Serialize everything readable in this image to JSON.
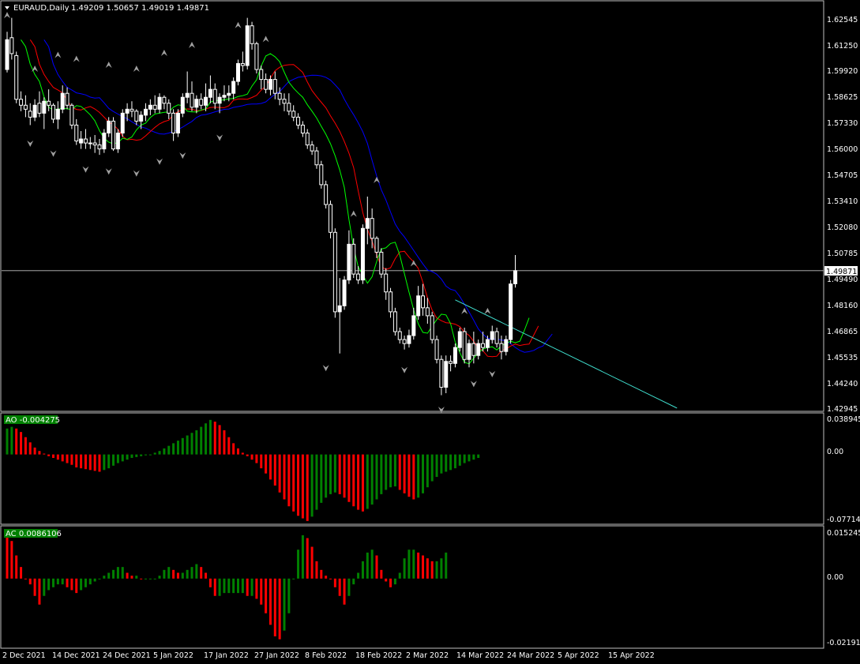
{
  "header": {
    "symbol_timeframe": "EURAUD,Daily",
    "ohlc": "1.49209 1.50657 1.49019 1.49871"
  },
  "main_scale": {
    "ticks": [
      "1.62545",
      "1.61250",
      "1.59920",
      "1.58625",
      "1.57330",
      "1.56000",
      "1.54705",
      "1.53410",
      "1.52080",
      "1.50785",
      "1.49490",
      "1.48160",
      "1.46865",
      "1.45535",
      "1.44240",
      "1.42945"
    ],
    "current_price_label": "1.49871"
  },
  "ao_panel": {
    "label": "AO -0.004275",
    "ticks": [
      "0.038945",
      "0.00",
      "-0.077144"
    ]
  },
  "ac_panel": {
    "label": "AC 0.0086106",
    "ticks": [
      "0.0152458",
      "0.00",
      "-0.0219111"
    ]
  },
  "time_axis": {
    "labels": [
      "2 Dec 2021",
      "14 Dec 2021",
      "24 Dec 2021",
      "5 Jan 2022",
      "17 Jan 2022",
      "27 Jan 2022",
      "8 Feb 2022",
      "18 Feb 2022",
      "2 Mar 2022",
      "14 Mar 2022",
      "24 Mar 2022",
      "5 Apr 2022",
      "15 Apr 2022"
    ]
  },
  "colors": {
    "background": "#000000",
    "bull_candle": "#ffffff",
    "bear_candle": "#000000",
    "green_bar": "#008000",
    "red_bar": "#ff0000",
    "ma_blue": "#0000ff",
    "ma_red": "#ff0000",
    "ma_green": "#00ff00",
    "trendline": "#40e0d0",
    "price_line": "#c0c0c0"
  },
  "chart_data": {
    "type": "candlestick",
    "symbol": "EURAUD",
    "timeframe": "Daily",
    "candles": [
      {
        "o": 1.6,
        "h": 1.619,
        "l": 1.5985,
        "c": 1.615
      },
      {
        "o": 1.616,
        "h": 1.626,
        "l": 1.605,
        "c": 1.608
      },
      {
        "o": 1.607,
        "h": 1.609,
        "l": 1.583,
        "c": 1.585
      },
      {
        "o": 1.585,
        "h": 1.589,
        "l": 1.579,
        "c": 1.582
      },
      {
        "o": 1.582,
        "h": 1.587,
        "l": 1.576,
        "c": 1.58
      },
      {
        "o": 1.579,
        "h": 1.583,
        "l": 1.572,
        "c": 1.576
      },
      {
        "o": 1.576,
        "h": 1.585,
        "l": 1.574,
        "c": 1.582
      },
      {
        "o": 1.583,
        "h": 1.589,
        "l": 1.576,
        "c": 1.578
      },
      {
        "o": 1.578,
        "h": 1.586,
        "l": 1.57,
        "c": 1.584
      },
      {
        "o": 1.584,
        "h": 1.59,
        "l": 1.579,
        "c": 1.582
      },
      {
        "o": 1.582,
        "h": 1.583,
        "l": 1.573,
        "c": 1.575
      },
      {
        "o": 1.575,
        "h": 1.584,
        "l": 1.57,
        "c": 1.58
      },
      {
        "o": 1.58,
        "h": 1.592,
        "l": 1.578,
        "c": 1.588
      },
      {
        "o": 1.588,
        "h": 1.591,
        "l": 1.58,
        "c": 1.582
      },
      {
        "o": 1.582,
        "h": 1.583,
        "l": 1.57,
        "c": 1.572
      },
      {
        "o": 1.572,
        "h": 1.575,
        "l": 1.562,
        "c": 1.564
      },
      {
        "o": 1.563,
        "h": 1.569,
        "l": 1.56,
        "c": 1.565
      },
      {
        "o": 1.565,
        "h": 1.57,
        "l": 1.56,
        "c": 1.563
      },
      {
        "o": 1.563,
        "h": 1.566,
        "l": 1.56,
        "c": 1.563
      },
      {
        "o": 1.563,
        "h": 1.567,
        "l": 1.558,
        "c": 1.562
      },
      {
        "o": 1.562,
        "h": 1.565,
        "l": 1.557,
        "c": 1.56
      },
      {
        "o": 1.56,
        "h": 1.57,
        "l": 1.558,
        "c": 1.568
      },
      {
        "o": 1.568,
        "h": 1.576,
        "l": 1.566,
        "c": 1.574
      },
      {
        "o": 1.574,
        "h": 1.576,
        "l": 1.559,
        "c": 1.56
      },
      {
        "o": 1.56,
        "h": 1.57,
        "l": 1.558,
        "c": 1.568
      },
      {
        "o": 1.568,
        "h": 1.58,
        "l": 1.566,
        "c": 1.578
      },
      {
        "o": 1.578,
        "h": 1.583,
        "l": 1.574,
        "c": 1.58
      },
      {
        "o": 1.58,
        "h": 1.584,
        "l": 1.576,
        "c": 1.579
      },
      {
        "o": 1.579,
        "h": 1.58,
        "l": 1.572,
        "c": 1.574
      },
      {
        "o": 1.574,
        "h": 1.579,
        "l": 1.57,
        "c": 1.577
      },
      {
        "o": 1.577,
        "h": 1.583,
        "l": 1.574,
        "c": 1.58
      },
      {
        "o": 1.58,
        "h": 1.585,
        "l": 1.577,
        "c": 1.582
      },
      {
        "o": 1.582,
        "h": 1.587,
        "l": 1.578,
        "c": 1.58
      },
      {
        "o": 1.58,
        "h": 1.588,
        "l": 1.578,
        "c": 1.586
      },
      {
        "o": 1.586,
        "h": 1.587,
        "l": 1.58,
        "c": 1.583
      },
      {
        "o": 1.583,
        "h": 1.585,
        "l": 1.575,
        "c": 1.578
      },
      {
        "o": 1.578,
        "h": 1.58,
        "l": 1.564,
        "c": 1.568
      },
      {
        "o": 1.568,
        "h": 1.58,
        "l": 1.566,
        "c": 1.578
      },
      {
        "o": 1.578,
        "h": 1.588,
        "l": 1.576,
        "c": 1.586
      },
      {
        "o": 1.586,
        "h": 1.599,
        "l": 1.583,
        "c": 1.588
      },
      {
        "o": 1.588,
        "h": 1.594,
        "l": 1.579,
        "c": 1.581
      },
      {
        "o": 1.581,
        "h": 1.587,
        "l": 1.578,
        "c": 1.585
      },
      {
        "o": 1.585,
        "h": 1.588,
        "l": 1.58,
        "c": 1.582
      },
      {
        "o": 1.582,
        "h": 1.593,
        "l": 1.579,
        "c": 1.586
      },
      {
        "o": 1.586,
        "h": 1.597,
        "l": 1.583,
        "c": 1.59
      },
      {
        "o": 1.59,
        "h": 1.593,
        "l": 1.58,
        "c": 1.583
      },
      {
        "o": 1.583,
        "h": 1.588,
        "l": 1.578,
        "c": 1.586
      },
      {
        "o": 1.586,
        "h": 1.592,
        "l": 1.584,
        "c": 1.587
      },
      {
        "o": 1.587,
        "h": 1.592,
        "l": 1.584,
        "c": 1.588
      },
      {
        "o": 1.588,
        "h": 1.596,
        "l": 1.585,
        "c": 1.594
      },
      {
        "o": 1.594,
        "h": 1.605,
        "l": 1.592,
        "c": 1.603
      },
      {
        "o": 1.603,
        "h": 1.609,
        "l": 1.599,
        "c": 1.602
      },
      {
        "o": 1.602,
        "h": 1.626,
        "l": 1.6,
        "c": 1.622
      },
      {
        "o": 1.622,
        "h": 1.624,
        "l": 1.61,
        "c": 1.613
      },
      {
        "o": 1.613,
        "h": 1.614,
        "l": 1.598,
        "c": 1.6
      },
      {
        "o": 1.6,
        "h": 1.602,
        "l": 1.59,
        "c": 1.595
      },
      {
        "o": 1.595,
        "h": 1.598,
        "l": 1.588,
        "c": 1.59
      },
      {
        "o": 1.59,
        "h": 1.597,
        "l": 1.587,
        "c": 1.595
      },
      {
        "o": 1.595,
        "h": 1.599,
        "l": 1.585,
        "c": 1.588
      },
      {
        "o": 1.588,
        "h": 1.591,
        "l": 1.582,
        "c": 1.585
      },
      {
        "o": 1.585,
        "h": 1.588,
        "l": 1.579,
        "c": 1.583
      },
      {
        "o": 1.583,
        "h": 1.588,
        "l": 1.577,
        "c": 1.579
      },
      {
        "o": 1.579,
        "h": 1.582,
        "l": 1.574,
        "c": 1.576
      },
      {
        "o": 1.576,
        "h": 1.578,
        "l": 1.57,
        "c": 1.572
      },
      {
        "o": 1.572,
        "h": 1.574,
        "l": 1.566,
        "c": 1.568
      },
      {
        "o": 1.568,
        "h": 1.57,
        "l": 1.56,
        "c": 1.562
      },
      {
        "o": 1.562,
        "h": 1.564,
        "l": 1.557,
        "c": 1.559
      },
      {
        "o": 1.559,
        "h": 1.561,
        "l": 1.55,
        "c": 1.552
      },
      {
        "o": 1.552,
        "h": 1.554,
        "l": 1.54,
        "c": 1.542
      },
      {
        "o": 1.542,
        "h": 1.544,
        "l": 1.53,
        "c": 1.532
      },
      {
        "o": 1.532,
        "h": 1.534,
        "l": 1.515,
        "c": 1.518
      },
      {
        "o": 1.518,
        "h": 1.52,
        "l": 1.475,
        "c": 1.478
      },
      {
        "o": 1.478,
        "h": 1.495,
        "l": 1.457,
        "c": 1.481
      },
      {
        "o": 1.481,
        "h": 1.496,
        "l": 1.479,
        "c": 1.494
      },
      {
        "o": 1.494,
        "h": 1.519,
        "l": 1.492,
        "c": 1.512
      },
      {
        "o": 1.512,
        "h": 1.515,
        "l": 1.495,
        "c": 1.497
      },
      {
        "o": 1.497,
        "h": 1.501,
        "l": 1.492,
        "c": 1.494
      },
      {
        "o": 1.494,
        "h": 1.522,
        "l": 1.492,
        "c": 1.52
      },
      {
        "o": 1.52,
        "h": 1.536,
        "l": 1.512,
        "c": 1.525
      },
      {
        "o": 1.525,
        "h": 1.53,
        "l": 1.51,
        "c": 1.515
      },
      {
        "o": 1.515,
        "h": 1.516,
        "l": 1.505,
        "c": 1.508
      },
      {
        "o": 1.508,
        "h": 1.51,
        "l": 1.495,
        "c": 1.497
      },
      {
        "o": 1.497,
        "h": 1.5,
        "l": 1.484,
        "c": 1.488
      },
      {
        "o": 1.488,
        "h": 1.49,
        "l": 1.475,
        "c": 1.478
      },
      {
        "o": 1.478,
        "h": 1.48,
        "l": 1.466,
        "c": 1.468
      },
      {
        "o": 1.468,
        "h": 1.47,
        "l": 1.462,
        "c": 1.464
      },
      {
        "o": 1.464,
        "h": 1.466,
        "l": 1.459,
        "c": 1.462
      },
      {
        "o": 1.462,
        "h": 1.469,
        "l": 1.46,
        "c": 1.466
      },
      {
        "o": 1.466,
        "h": 1.48,
        "l": 1.464,
        "c": 1.476
      },
      {
        "o": 1.476,
        "h": 1.491,
        "l": 1.474,
        "c": 1.486
      },
      {
        "o": 1.486,
        "h": 1.492,
        "l": 1.476,
        "c": 1.48
      },
      {
        "o": 1.48,
        "h": 1.485,
        "l": 1.472,
        "c": 1.476
      },
      {
        "o": 1.476,
        "h": 1.478,
        "l": 1.462,
        "c": 1.464
      },
      {
        "o": 1.464,
        "h": 1.466,
        "l": 1.452,
        "c": 1.454
      },
      {
        "o": 1.454,
        "h": 1.456,
        "l": 1.436,
        "c": 1.44
      },
      {
        "o": 1.44,
        "h": 1.456,
        "l": 1.437,
        "c": 1.453
      },
      {
        "o": 1.453,
        "h": 1.456,
        "l": 1.448,
        "c": 1.452
      },
      {
        "o": 1.452,
        "h": 1.462,
        "l": 1.45,
        "c": 1.46
      },
      {
        "o": 1.46,
        "h": 1.47,
        "l": 1.458,
        "c": 1.468
      },
      {
        "o": 1.468,
        "h": 1.47,
        "l": 1.452,
        "c": 1.454
      },
      {
        "o": 1.454,
        "h": 1.464,
        "l": 1.45,
        "c": 1.462
      },
      {
        "o": 1.462,
        "h": 1.468,
        "l": 1.452,
        "c": 1.456
      },
      {
        "o": 1.456,
        "h": 1.464,
        "l": 1.454,
        "c": 1.462
      },
      {
        "o": 1.462,
        "h": 1.468,
        "l": 1.458,
        "c": 1.46
      },
      {
        "o": 1.46,
        "h": 1.466,
        "l": 1.458,
        "c": 1.464
      },
      {
        "o": 1.464,
        "h": 1.471,
        "l": 1.462,
        "c": 1.468
      },
      {
        "o": 1.468,
        "h": 1.47,
        "l": 1.46,
        "c": 1.462
      },
      {
        "o": 1.462,
        "h": 1.466,
        "l": 1.454,
        "c": 1.458
      },
      {
        "o": 1.458,
        "h": 1.466,
        "l": 1.456,
        "c": 1.464
      },
      {
        "o": 1.464,
        "h": 1.494,
        "l": 1.462,
        "c": 1.492
      },
      {
        "o": 1.4921,
        "h": 1.5066,
        "l": 1.4902,
        "c": 1.4987
      }
    ],
    "ao": [
      0.03,
      0.032,
      0.03,
      0.026,
      0.02,
      0.014,
      0.008,
      0.004,
      0.001,
      -0.002,
      -0.004,
      -0.006,
      -0.008,
      -0.01,
      -0.012,
      -0.015,
      -0.016,
      -0.017,
      -0.018,
      -0.019,
      -0.02,
      -0.018,
      -0.016,
      -0.013,
      -0.01,
      -0.008,
      -0.006,
      -0.004,
      -0.003,
      -0.002,
      -0.001,
      0.0,
      0.002,
      0.004,
      0.007,
      0.01,
      0.013,
      0.016,
      0.019,
      0.022,
      0.025,
      0.028,
      0.032,
      0.036,
      0.04,
      0.038,
      0.034,
      0.028,
      0.02,
      0.013,
      0.007,
      0.002,
      -0.002,
      -0.006,
      -0.01,
      -0.016,
      -0.022,
      -0.029,
      -0.036,
      -0.044,
      -0.052,
      -0.06,
      -0.066,
      -0.071,
      -0.074,
      -0.077,
      -0.072,
      -0.064,
      -0.056,
      -0.05,
      -0.046,
      -0.044,
      -0.046,
      -0.05,
      -0.055,
      -0.06,
      -0.064,
      -0.066,
      -0.063,
      -0.058,
      -0.052,
      -0.046,
      -0.041,
      -0.038,
      -0.037,
      -0.041,
      -0.045,
      -0.049,
      -0.052,
      -0.05,
      -0.045,
      -0.038,
      -0.031,
      -0.026,
      -0.022,
      -0.02,
      -0.018,
      -0.016,
      -0.013,
      -0.01,
      -0.008,
      -0.006,
      -0.004
    ],
    "ac": [
      0.015,
      0.013,
      0.008,
      0.004,
      0.0,
      -0.002,
      -0.006,
      -0.009,
      -0.006,
      -0.004,
      -0.003,
      -0.002,
      -0.002,
      -0.003,
      -0.004,
      -0.005,
      -0.004,
      -0.003,
      -0.002,
      -0.001,
      0.0,
      0.001,
      0.002,
      0.003,
      0.004,
      0.004,
      0.002,
      0.001,
      0.001,
      0.0,
      0.0,
      0.0,
      0.0,
      0.001,
      0.003,
      0.004,
      0.003,
      0.002,
      0.002,
      0.003,
      0.004,
      0.005,
      0.004,
      0.002,
      -0.003,
      -0.006,
      -0.006,
      -0.005,
      -0.005,
      -0.005,
      -0.005,
      -0.005,
      -0.006,
      -0.006,
      -0.007,
      -0.009,
      -0.012,
      -0.016,
      -0.02,
      -0.021,
      -0.018,
      -0.012,
      0.0,
      0.01,
      0.015,
      0.014,
      0.011,
      0.006,
      0.003,
      0.001,
      0.0,
      -0.003,
      -0.006,
      -0.009,
      -0.006,
      -0.002,
      0.002,
      0.006,
      0.009,
      0.01,
      0.008,
      0.003,
      -0.001,
      -0.003,
      -0.002,
      0.002,
      0.007,
      0.01,
      0.01,
      0.009,
      0.008,
      0.007,
      0.006,
      0.006,
      0.007,
      0.009
    ],
    "markers_up": [
      [
        0,
        1.625
      ],
      [
        6,
        1.598
      ],
      [
        11,
        1.605
      ],
      [
        15,
        1.603
      ],
      [
        22,
        1.6
      ],
      [
        28,
        1.598
      ],
      [
        34,
        1.606
      ],
      [
        40,
        1.61
      ],
      [
        50,
        1.62
      ],
      [
        53,
        1.636
      ],
      [
        56,
        1.613
      ],
      [
        75,
        1.525
      ],
      [
        80,
        1.542
      ],
      [
        88,
        1.5
      ],
      [
        99,
        1.476
      ],
      [
        104,
        1.476
      ]
    ],
    "markers_down": [
      [
        5,
        1.565
      ],
      [
        10,
        1.56
      ],
      [
        17,
        1.552
      ],
      [
        22,
        1.551
      ],
      [
        28,
        1.55
      ],
      [
        33,
        1.556
      ],
      [
        38,
        1.559
      ],
      [
        46,
        1.568
      ],
      [
        69,
        1.452
      ],
      [
        86,
        1.451
      ],
      [
        94,
        1.431
      ],
      [
        101,
        1.444
      ],
      [
        105,
        1.449
      ]
    ]
  }
}
